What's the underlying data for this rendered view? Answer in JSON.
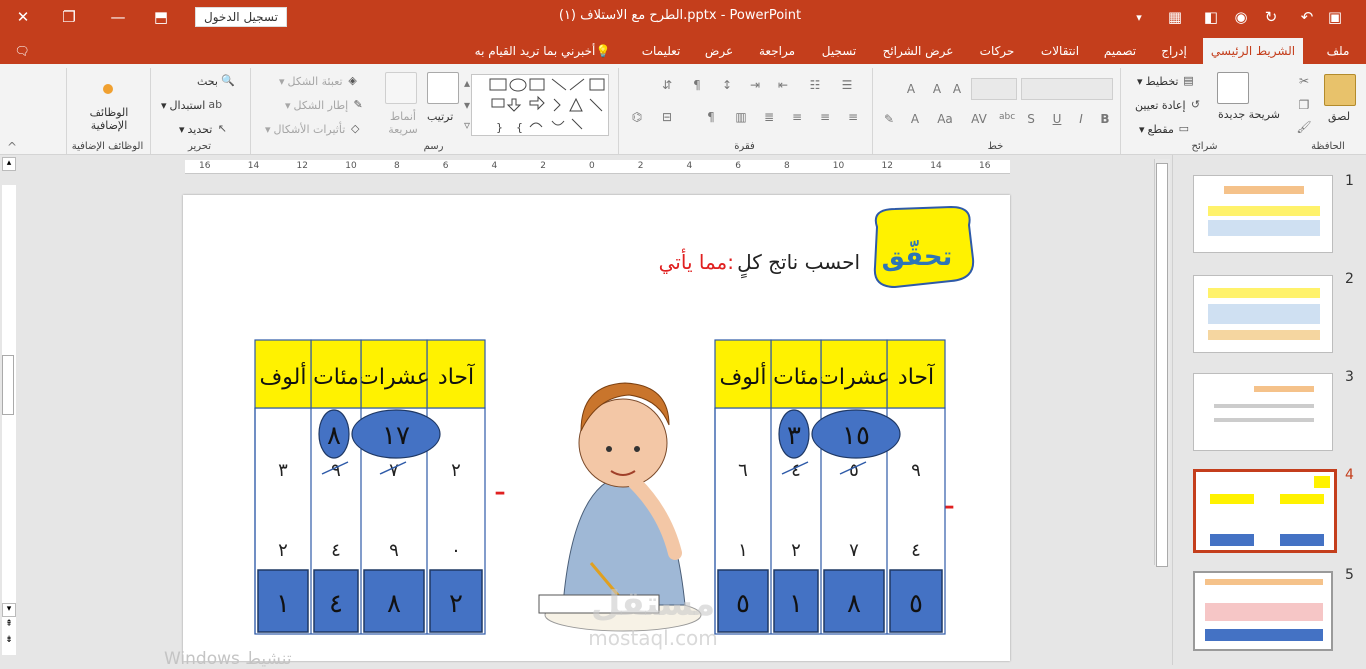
{
  "titlebar": {
    "title": "الطرح مع الاستلاف (١).pptx  -  PowerPoint",
    "sign_in": "تسجيل الدخول"
  },
  "tabs": [
    "ملف",
    "الشريط الرئيسي",
    "إدراج",
    "تصميم",
    "انتقالات",
    "حركات",
    "عرض الشرائح",
    "تسجيل",
    "مراجعة",
    "عرض",
    "تعليمات",
    "أخبرني بما تريد القيام به"
  ],
  "ribbon": {
    "clipboard": {
      "label": "الحافظة",
      "paste": "لصق"
    },
    "slides": {
      "label": "شرائح",
      "new_slide": "شريحة جديدة",
      "layout": "تخطيط",
      "reset": "إعادة تعيين",
      "section": "مقطع"
    },
    "font": {
      "label": "خط"
    },
    "paragraph": {
      "label": "فقرة"
    },
    "drawing": {
      "label": "رسم",
      "arrange": "ترتيب",
      "quick_styles": "أنماط سريعة",
      "shape_fill": "تعبئة الشكل",
      "shape_outline": "إطار الشكل",
      "shape_effects": "تأثيرات الأشكال"
    },
    "editing": {
      "label": "تحرير",
      "find": "بحث",
      "replace": "استبدال",
      "select": "تحديد"
    },
    "addins": {
      "label": "الوظائف الإضافية",
      "addins": "الوظائف الإضافية"
    }
  },
  "ruler": {
    "labels": [
      "16",
      "14",
      "12",
      "10",
      "8",
      "6",
      "4",
      "2",
      "0",
      "2",
      "4",
      "6",
      "8",
      "10",
      "12",
      "14",
      "16"
    ]
  },
  "slide": {
    "badge": "تحقّق",
    "instruction_black": "احسب ناتج كلٍ",
    "instruction_red": "مما يأتي:",
    "headers": [
      "آحاد",
      "عشرات",
      "مئات",
      "ألوف"
    ],
    "right_problem": {
      "ovals": {
        "hundreds": "٣",
        "tens": "١٥"
      },
      "top": {
        "ones": "٩",
        "tens": "٥",
        "hundreds": "٤",
        "thousands": "٦"
      },
      "bottom": {
        "ones": "٤",
        "tens": "٧",
        "hundreds": "٢",
        "thousands": "١"
      },
      "result": {
        "ones": "٥",
        "tens": "٨",
        "hundreds": "١",
        "thousands": "٥"
      }
    },
    "left_problem": {
      "ovals": {
        "hundreds": "٨",
        "tens": "١٧"
      },
      "top": {
        "ones": "٢",
        "tens": "٧",
        "hundreds": "٩",
        "thousands": "٣"
      },
      "bottom": {
        "ones": "٠",
        "tens": "٩",
        "hundreds": "٤",
        "thousands": "٢"
      },
      "result": {
        "ones": "٢",
        "tens": "٨",
        "hundreds": "٤",
        "thousands": "١"
      }
    },
    "minus": "–",
    "watermark_ar": "مستقل",
    "watermark_en": "mostaql.com"
  },
  "windows_watermark": "Windows تنشيط",
  "thumbnails": [
    "1",
    "2",
    "3",
    "4",
    "5"
  ],
  "colors": {
    "accent": "#c43e1c",
    "header_yellow": "#fff200",
    "box_blue": "#4472c4",
    "red_text": "#e02020"
  }
}
